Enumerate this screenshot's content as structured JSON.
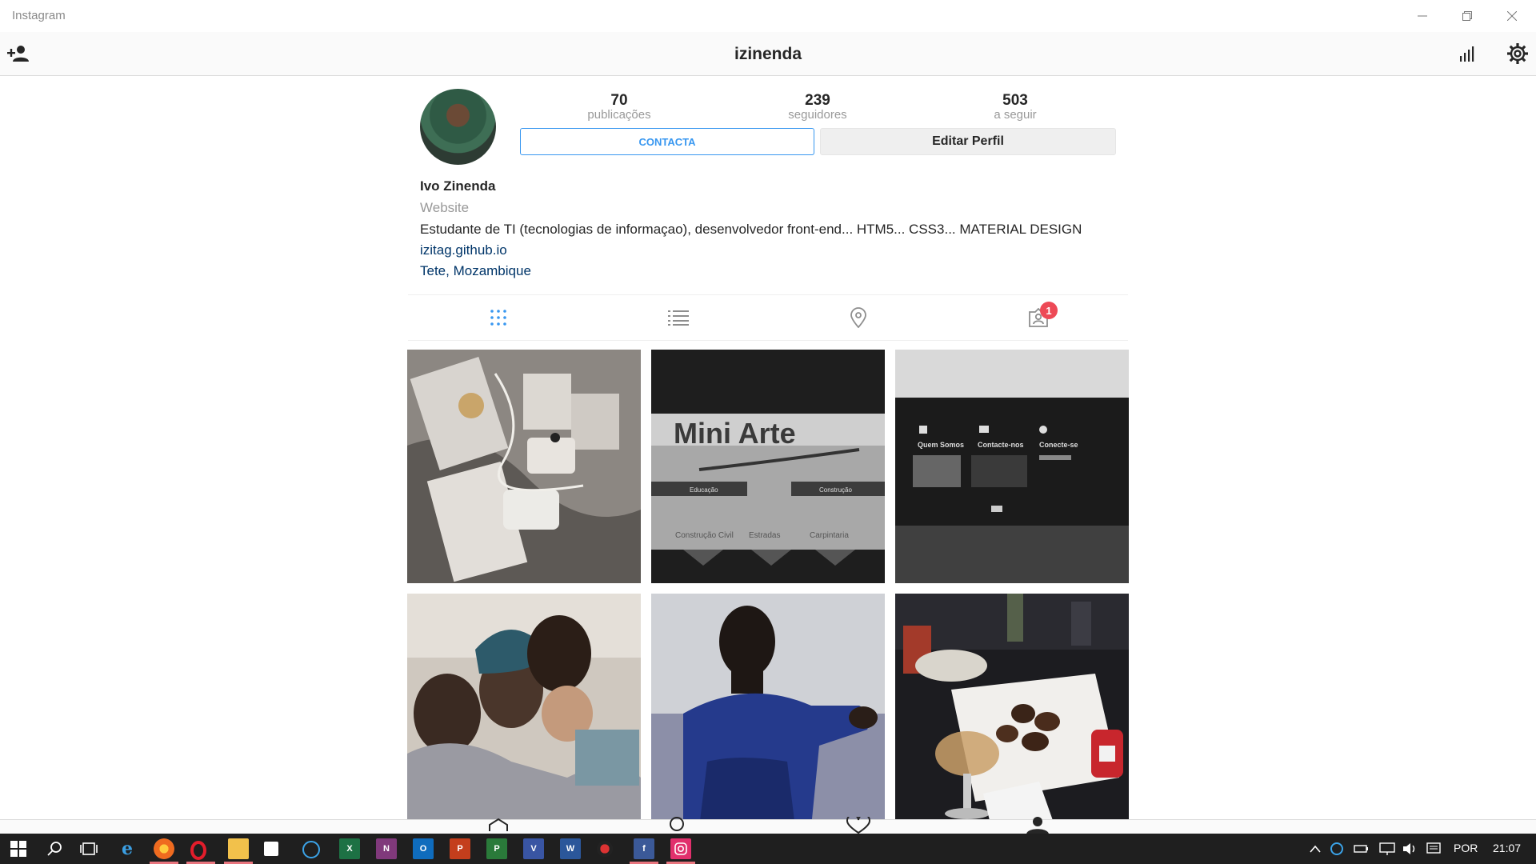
{
  "window": {
    "title": "Instagram"
  },
  "header": {
    "username": "izinenda"
  },
  "profile": {
    "stats": [
      {
        "value": "70",
        "label": "publicações"
      },
      {
        "value": "239",
        "label": "seguidores"
      },
      {
        "value": "503",
        "label": "a seguir"
      }
    ],
    "contact_label": "CONTACTA",
    "edit_label": "Editar Perfil",
    "full_name": "Ivo Zinenda",
    "category": "Website",
    "bio": "Estudante de TI (tecnologias de informaçao), desenvolvedor front-end... HTM5... CSS3... MATERIAL DESIGN",
    "link": "izitag.github.io",
    "location": "Tete, Mozambique"
  },
  "tabs": {
    "tagged_badge": "1"
  },
  "grid": {
    "tiles": [
      {
        "alt": "iPhone box and accessories"
      },
      {
        "alt": "Mini Arte website on screen",
        "text_main": "Mini Arte",
        "text_1": "Educação",
        "text_2": "Construção",
        "text_3": "Construção Civil",
        "text_4": "Estradas",
        "text_5": "Carpintaria"
      },
      {
        "alt": "Website footer on screen",
        "text_1": "Quem Somos",
        "text_2": "Contacte-nos",
        "text_3": "Conecte-se"
      },
      {
        "alt": "Family selfie"
      },
      {
        "alt": "Selfie"
      },
      {
        "alt": "Dinner plate with drinks"
      }
    ]
  },
  "taskbar": {
    "language": "POR",
    "time": "21:07"
  },
  "colors": {
    "accent_blue": "#3897f0",
    "link_navy": "#003569",
    "badge_red": "#ed4956",
    "taskbar": "#1f1f1f"
  }
}
